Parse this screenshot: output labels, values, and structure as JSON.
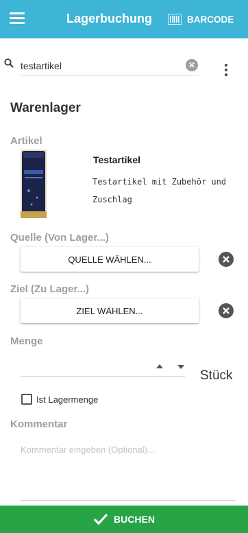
{
  "header": {
    "title": "Lagerbuchung",
    "barcode_label": "BARCODE",
    "bg_color": "#3eb4d6"
  },
  "search": {
    "value": "testartikel",
    "icons": [
      "search-icon",
      "clear-icon",
      "more-vert-icon"
    ]
  },
  "section": {
    "title": "Warenlager"
  },
  "article": {
    "label": "Artikel",
    "name": "Testartikel",
    "description": "Testartikel mit Zubehör und Zuschlag"
  },
  "source": {
    "label": "Quelle (Von Lager...)",
    "button_label": "QUELLE WÄHLEN..."
  },
  "target": {
    "label": "Ziel (Zu Lager...)",
    "button_label": "ZIEL WÄHLEN..."
  },
  "quantity": {
    "label": "Menge",
    "value": "",
    "unit": "Stück"
  },
  "stock_checkbox": {
    "label": "Ist Lagermenge",
    "checked": false
  },
  "comment": {
    "label": "Kommentar",
    "placeholder": "Kommentar eingeben (Optional)..."
  },
  "footer": {
    "book_label": "BUCHEN",
    "bg_color": "#27a446"
  }
}
